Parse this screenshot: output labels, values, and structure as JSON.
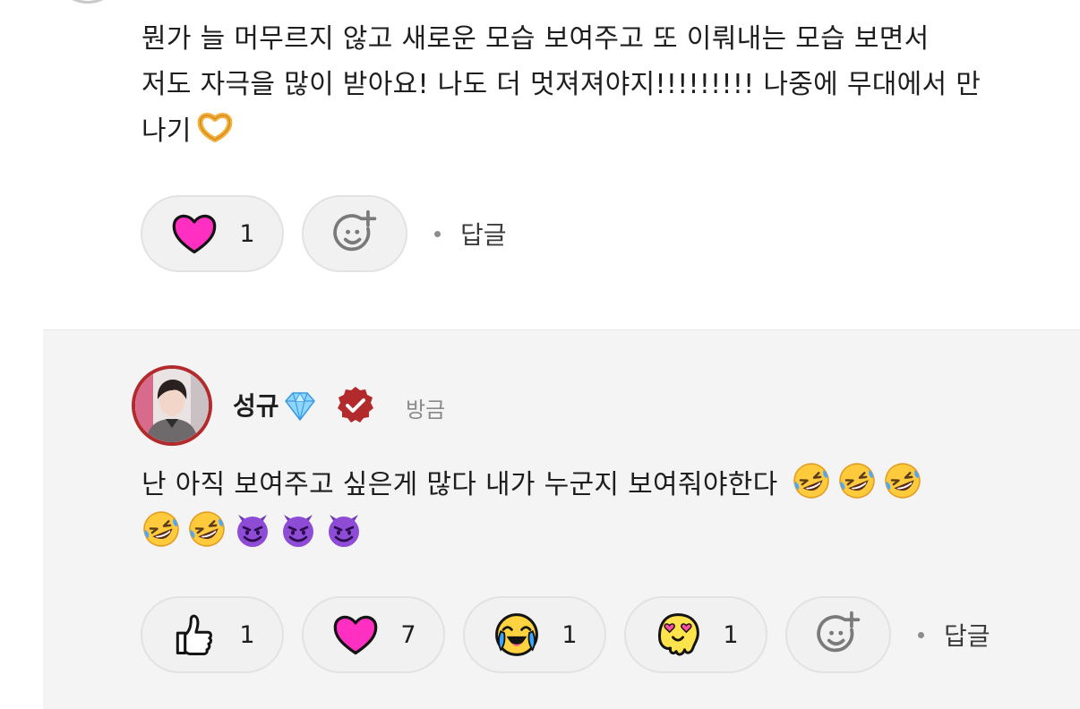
{
  "previous_comment": {
    "text_line1": "뭔가 늘 머무르지 않고 새로운 모습 보여주고 또 이뤄내는 모습 보면서",
    "text_line2": "저도 자극을 많이 받아요! 나도 더 멋져져야지!!!!!!!!! 나중에 무대에서 만",
    "text_line3": "나기",
    "text_emoji": "heart-hands-emoji",
    "reactions": [
      {
        "emoji": "pink-heart-emoji",
        "count": "1"
      }
    ],
    "add_reaction_icon": "smile-plus-icon",
    "reply_label": "답글"
  },
  "reply": {
    "author": "성규",
    "author_badge": "gem-emoji",
    "verified_badge": "verified-check-icon",
    "timestamp": "방금",
    "text": "난 아직 보여주고 싶은게 많다 내가 누군지 보여줘야한다",
    "text_emojis": [
      "rofl-emoji",
      "rofl-emoji",
      "rofl-emoji",
      "rofl-emoji",
      "rofl-emoji",
      "smiling-devil-emoji",
      "smiling-devil-emoji",
      "smiling-devil-emoji"
    ],
    "reactions": [
      {
        "emoji": "thumbs-up-emoji",
        "count": "1"
      },
      {
        "emoji": "pink-heart-emoji",
        "count": "7"
      },
      {
        "emoji": "crying-face-emoji",
        "count": "1"
      },
      {
        "emoji": "heart-eyes-blob-emoji",
        "count": "1"
      }
    ],
    "add_reaction_icon": "smile-plus-icon",
    "reply_label": "답글"
  },
  "colors": {
    "heart_pink": "#ff2fc1",
    "verified_red": "#b22a2c",
    "reply_background": "#f4f4f4",
    "pill_background": "#f1f1f1"
  }
}
